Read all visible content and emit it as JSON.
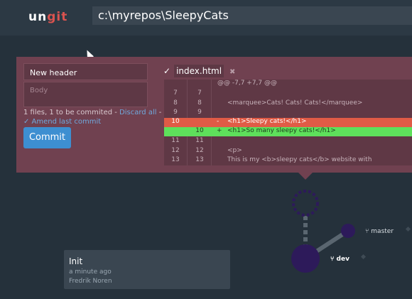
{
  "app": {
    "logo": {
      "part1": "un",
      "part2": "git"
    }
  },
  "header": {
    "repo_path": "c:\\myrepos\\SleepyCats"
  },
  "commit_form": {
    "header_value": "New header",
    "body_placeholder": "Body",
    "status_text": "1 files, 1 to be commited - ",
    "discard_label": "Discard all",
    "status_suffix": " -",
    "amend_label": "✓ Amend last commit",
    "commit_label": "Commit"
  },
  "diff": {
    "file_check": "✓",
    "file_name": "index.html",
    "close_glyph": "✖",
    "hunk": "@@ -7,7 +7,7 @@",
    "lines": [
      {
        "n1": "7",
        "n2": "7",
        "marker": "",
        "text": ""
      },
      {
        "n1": "8",
        "n2": "8",
        "marker": "",
        "text": "<marquee>Cats! Cats! Cats!</marquee>"
      },
      {
        "n1": "9",
        "n2": "9",
        "marker": "",
        "text": ""
      },
      {
        "n1": "10",
        "n2": "",
        "marker": "-",
        "text": "<h1>Sleepy cats!</h1>"
      },
      {
        "n1": "",
        "n2": "10",
        "marker": "+",
        "text": "<h1>So many sleepy cats!</h1>"
      },
      {
        "n1": "11",
        "n2": "11",
        "marker": "",
        "text": ""
      },
      {
        "n1": "12",
        "n2": "12",
        "marker": "",
        "text": "<p>"
      },
      {
        "n1": "13",
        "n2": "13",
        "marker": "",
        "text": "    This is my <b>sleepy cats</b> website with"
      }
    ]
  },
  "graph": {
    "commit": {
      "title": "Init",
      "date": "a minute ago",
      "author": "Fredrik Noren"
    },
    "branches": {
      "dev": "dev",
      "master": "master"
    },
    "branch_glyph": "⑂"
  },
  "colors": {
    "accent": "#3d8fd1",
    "deleted": "#e05b46",
    "added": "#5ee05b",
    "node": "#2d1a5a",
    "panel": "#704150"
  }
}
